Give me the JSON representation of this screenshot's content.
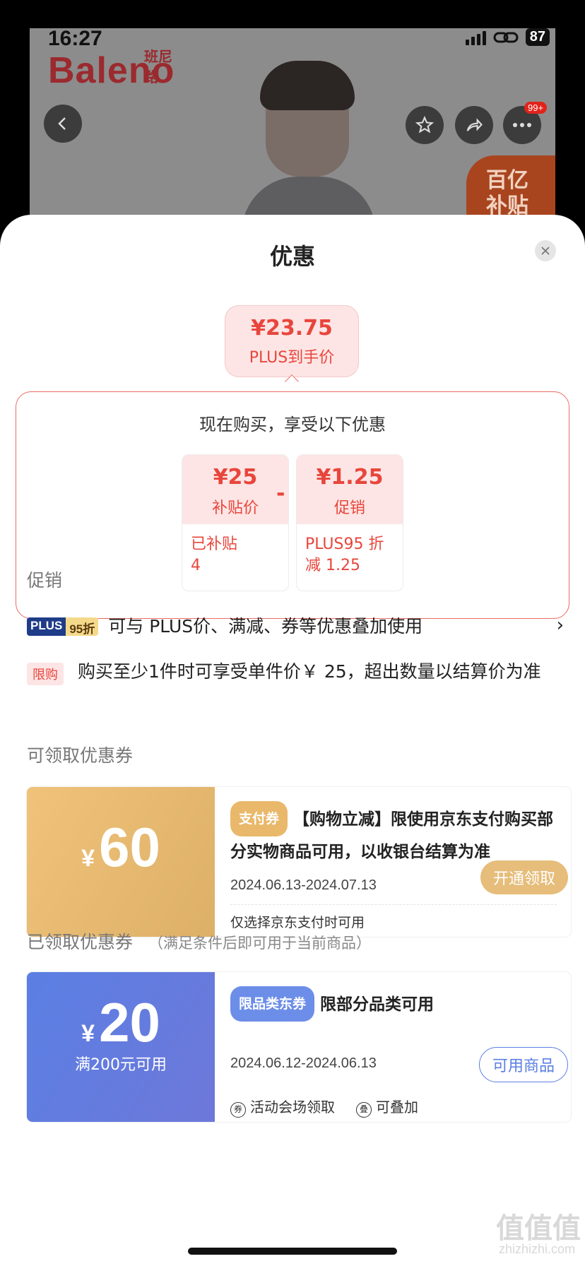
{
  "status_bar": {
    "time": "16:27",
    "battery": "87"
  },
  "product_banner": {
    "brand_en": "Baleno",
    "brand_cn": "班尼路",
    "notification_badge": "99+",
    "subsidy_tag": "百亿\n补贴"
  },
  "sheet": {
    "title": "优惠",
    "final_price": "¥23.75",
    "final_price_label": "PLUS到手价",
    "calc_heading": "现在购买，享受以下优惠",
    "calc_items": [
      {
        "amount": "¥25",
        "label": "补贴价",
        "detail": "已补贴\n4"
      },
      {
        "amount": "¥1.25",
        "label": "促销",
        "detail": "PLUS95 折\n减 1.25"
      }
    ],
    "operator": "-"
  },
  "promotions": {
    "section_label": "促销",
    "plus_row": {
      "tag_left": "PLUS",
      "tag_right": "95折",
      "text": "可与 PLUS价、满减、券等优惠叠加使用",
      "chevron": "›"
    },
    "limit_row": {
      "tag": "限购",
      "text": "购买至少1件时可享受单件价￥ 25，超出数量以结算价为准"
    }
  },
  "available_coupons": {
    "section_label": "可领取优惠券",
    "items": [
      {
        "currency": "¥",
        "amount": "60",
        "tag": "支付券",
        "title": "【购物立减】限使用京东支付购买部分实物商品可用，以收银台结算为准",
        "date": "2024.06.13-2024.07.13",
        "action": "开通领取",
        "note": "仅选择京东支付时可用"
      }
    ]
  },
  "claimed_coupons": {
    "section_label": "已领取优惠券",
    "section_hint": "（满足条件后即可用于当前商品）",
    "items": [
      {
        "currency": "¥",
        "amount": "20",
        "condition": "满200元可用",
        "tag": "限品类东券",
        "title": "限部分品类可用",
        "date": "2024.06.12-2024.06.13",
        "action": "可用商品",
        "note_a": "活动会场领取",
        "note_b": "可叠加"
      }
    ]
  },
  "watermark": {
    "main": "值值值",
    "sub": "zhizhizhi.com"
  },
  "colors": {
    "accent_red": "#e8463c",
    "gold": "#e6bd7a",
    "blue": "#5b7fe4",
    "plus_navy": "#1f3c88"
  }
}
